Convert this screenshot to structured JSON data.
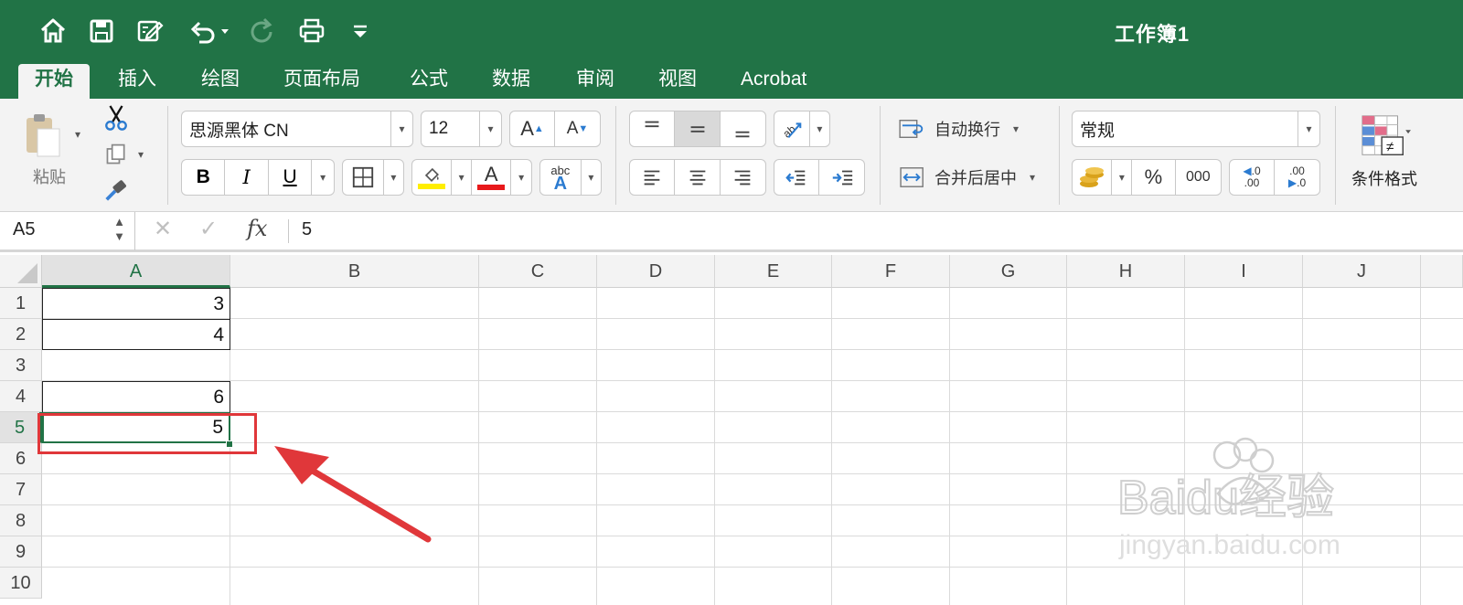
{
  "window": {
    "title": "工作簿1"
  },
  "quick_access": [
    "home-icon",
    "save-icon",
    "edit-icon",
    "undo-icon",
    "redo-icon",
    "print-icon",
    "customize-icon"
  ],
  "tabs": [
    "开始",
    "插入",
    "绘图",
    "页面布局",
    "公式",
    "数据",
    "审阅",
    "视图",
    "Acrobat"
  ],
  "active_tab": "开始",
  "ribbon": {
    "paste_label": "粘贴",
    "font_name": "思源黑体 CN",
    "font_size": "12",
    "bold": "B",
    "italic": "I",
    "underline": "U",
    "font_color_glyph": "A",
    "abc_glyph": "abc",
    "wrap_text": "自动换行",
    "merge_center": "合并后居中",
    "number_format": "常规",
    "percent": "%",
    "comma": "000",
    "inc_decimal_top": ".0",
    "inc_decimal_bottom": ".00",
    "dec_decimal_top": ".00",
    "dec_decimal_bottom": ".0",
    "conditional_format": "条件格式",
    "fill_color": "#ffee00",
    "text_color": "#e8191b"
  },
  "formula_bar": {
    "name_box": "A5",
    "fx": "fx",
    "value": "5"
  },
  "sheet": {
    "columns": [
      "A",
      "B",
      "C",
      "D",
      "E",
      "F",
      "G",
      "H",
      "I",
      "J"
    ],
    "rows": [
      "1",
      "2",
      "3",
      "4",
      "5",
      "6",
      "7",
      "8",
      "9",
      "10"
    ],
    "selected_cell": "A5",
    "cells": {
      "A1": "3",
      "A2": "4",
      "A4": "6",
      "A5": "5"
    }
  },
  "watermark": {
    "brand": "Baidu经验",
    "url": "jingyan.baidu.com"
  },
  "colors": {
    "excel_green": "#217346",
    "annotation_red": "#e0373a"
  }
}
